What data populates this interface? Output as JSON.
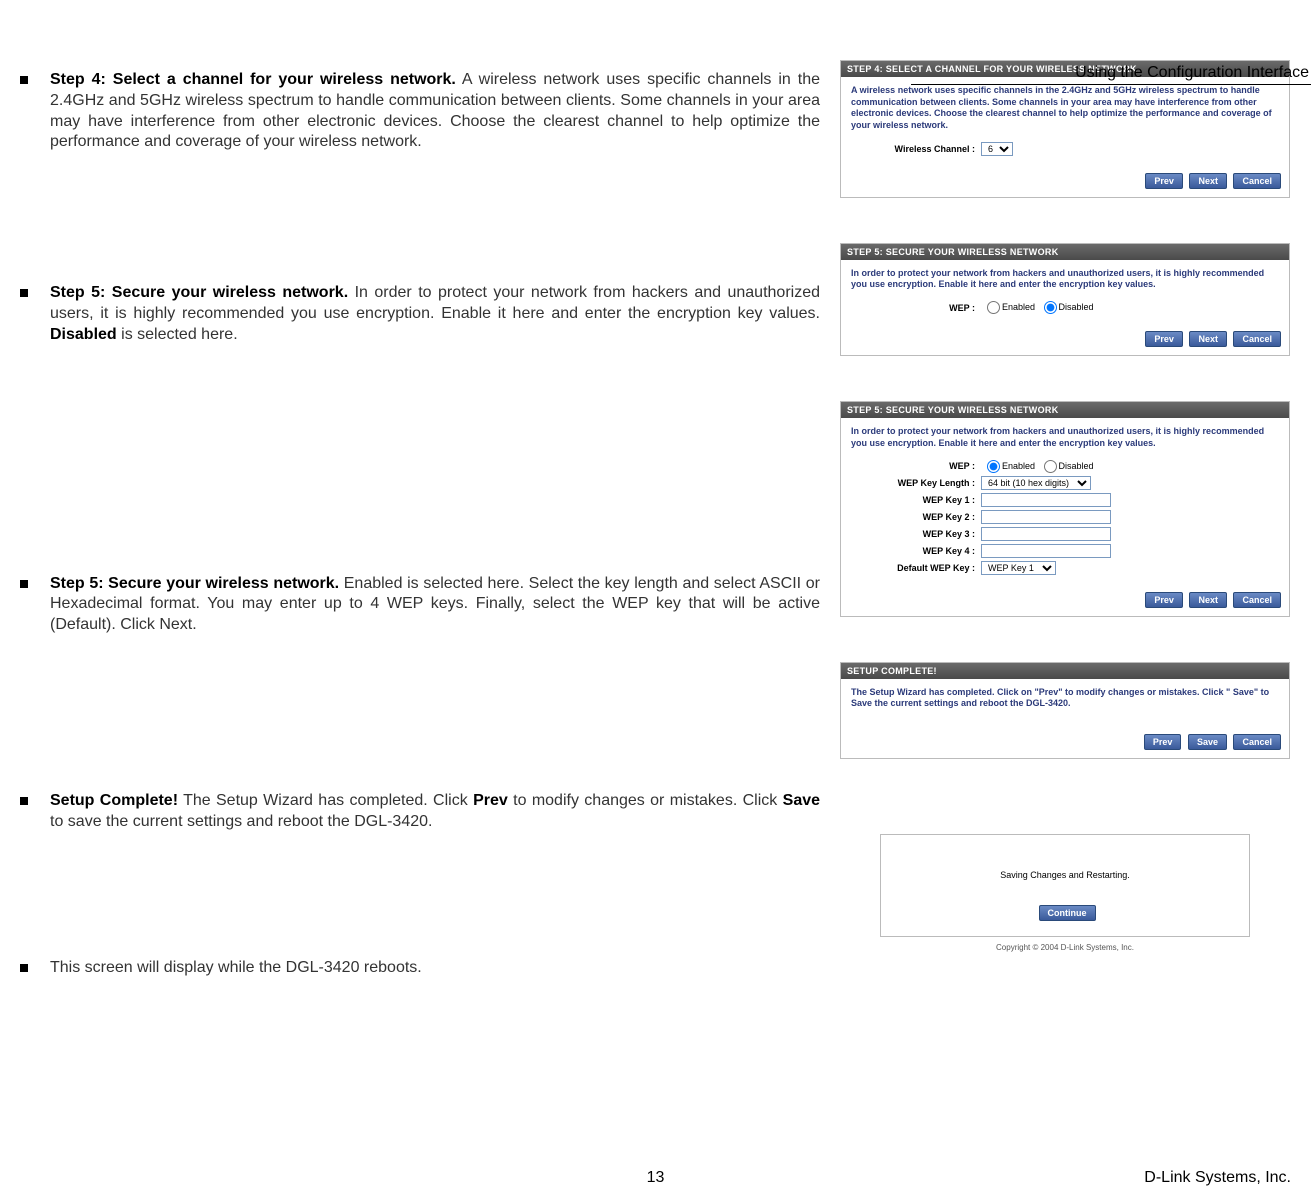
{
  "header": {
    "section_title": "Using the Configuration Interface"
  },
  "items": {
    "step4": {
      "title": "Step 4: Select a channel for your wireless network.",
      "body": " A wireless network uses specific channels in the 2.4GHz and 5GHz wireless spectrum to handle communication between clients. Some channels in your area may have interference from other electronic devices. Choose the clearest channel to help optimize the performance and coverage of your wireless network."
    },
    "step5a": {
      "title": "Step 5: Secure your wireless network.",
      "body_pre": " In order to protect your network from hackers and unauthorized users, it is highly recommended you use encryption. Enable it here and enter the encryption key values. ",
      "bold": "Disabled",
      "body_post": " is selected here."
    },
    "step5b": {
      "title": "Step 5: Secure your wireless network.",
      "body": " Enabled is selected here. Select the key length and select ASCII or Hexadecimal format. You may enter up to 4 WEP keys. Finally, select the WEP key that will be active (Default). Click Next."
    },
    "complete": {
      "title": "Setup Complete!",
      "body_pre": " The Setup Wizard has completed. Click ",
      "bold1": "Prev",
      "body_mid": " to modify changes or mistakes. Click ",
      "bold2": "Save",
      "body_post": " to save the current settings and reboot the DGL-3420."
    },
    "reboot": {
      "body": "This screen will display while the DGL-3420 reboots."
    }
  },
  "wizards": {
    "step4": {
      "header": "STEP 4: SELECT A CHANNEL FOR YOUR WIRELESS NETWORK",
      "desc": "A wireless network uses specific channels in the 2.4GHz and 5GHz wireless spectrum to handle communication between clients. Some channels in your area may have interference from other electronic devices. Choose the clearest channel to help optimize the performance and coverage of your wireless network.",
      "channel_label": "Wireless Channel :",
      "channel_value": "6",
      "btn_prev": "Prev",
      "btn_next": "Next",
      "btn_cancel": "Cancel"
    },
    "step5disabled": {
      "header": "STEP 5: SECURE YOUR WIRELESS NETWORK",
      "desc": "In order to protect your network from hackers and unauthorized users, it is highly recommended you use encryption. Enable it here and enter the encryption key values.",
      "wep_label": "WEP :",
      "opt_enabled": "Enabled",
      "opt_disabled": "Disabled",
      "btn_prev": "Prev",
      "btn_next": "Next",
      "btn_cancel": "Cancel"
    },
    "step5enabled": {
      "header": "STEP 5: SECURE YOUR WIRELESS NETWORK",
      "desc": "In order to protect your network from hackers and unauthorized users, it is highly recommended you use encryption. Enable it here and enter the encryption key values.",
      "wep_label": "WEP :",
      "opt_enabled": "Enabled",
      "opt_disabled": "Disabled",
      "keylen_label": "WEP Key Length :",
      "keylen_value": "64 bit (10 hex digits)",
      "key1_label": "WEP Key 1 :",
      "key2_label": "WEP Key 2 :",
      "key3_label": "WEP Key 3 :",
      "key4_label": "WEP Key 4 :",
      "default_label": "Default WEP Key :",
      "default_value": "WEP Key 1",
      "btn_prev": "Prev",
      "btn_next": "Next",
      "btn_cancel": "Cancel"
    },
    "complete": {
      "header": "SETUP COMPLETE!",
      "desc": "The Setup Wizard has completed. Click on \"Prev\" to modify changes or mistakes. Click \" Save\" to Save the current settings and reboot the DGL-3420.",
      "btn_prev": "Prev",
      "btn_save": "Save",
      "btn_cancel": "Cancel"
    },
    "reboot": {
      "msg": "Saving Changes and Restarting.",
      "btn_continue": "Continue",
      "copyright": "Copyright © 2004 D-Link Systems, Inc."
    }
  },
  "footer": {
    "page": "13",
    "company": "D-Link Systems, Inc."
  }
}
